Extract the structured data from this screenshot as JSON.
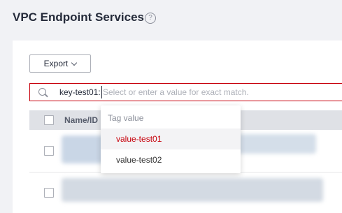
{
  "page": {
    "title": "VPC Endpoint Services",
    "help_icon": "?"
  },
  "toolbar": {
    "export_label": "Export"
  },
  "search": {
    "tag": "key-test01:",
    "placeholder": "Select or enter a value for exact match."
  },
  "table": {
    "columns": [
      "Name/ID"
    ]
  },
  "dropdown": {
    "header": "Tag value",
    "items": [
      "value-test01",
      "value-test02"
    ],
    "active_index": 0
  },
  "colors": {
    "accent": "#c7000b",
    "background": "#f1f2f5"
  }
}
